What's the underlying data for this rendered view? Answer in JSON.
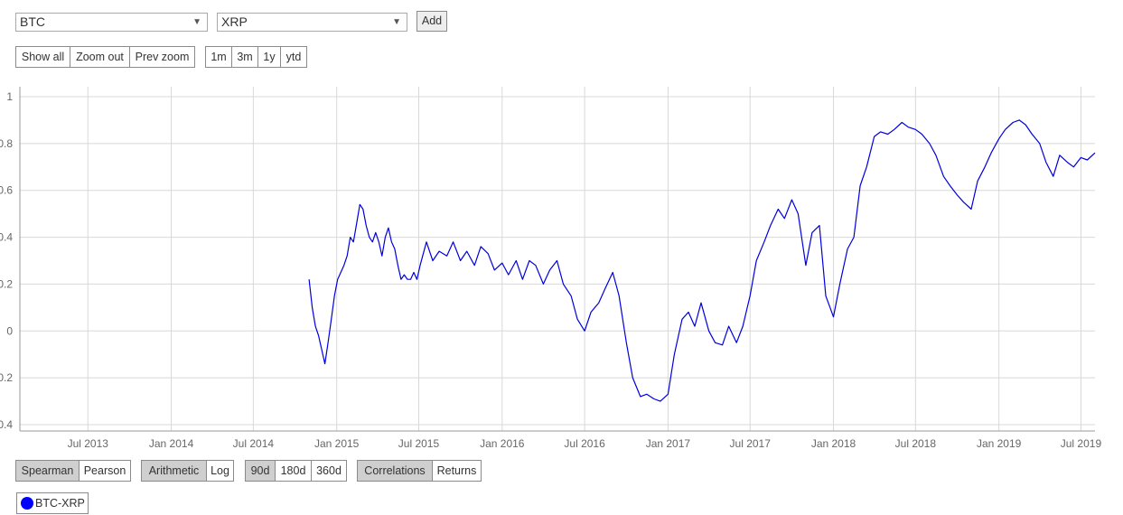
{
  "selects": {
    "first": {
      "value": "BTC"
    },
    "second": {
      "value": "XRP"
    }
  },
  "add_button": {
    "label": "Add"
  },
  "zoom_buttons": [
    "Show all",
    "Zoom out",
    "Prev zoom"
  ],
  "range_buttons": [
    "1m",
    "3m",
    "1y",
    "ytd"
  ],
  "method_buttons": {
    "active": "Spearman",
    "other": "Pearson"
  },
  "scale_buttons": {
    "active": "Arithmetic",
    "other": "Log"
  },
  "window_buttons": {
    "active": "90d",
    "b": "180d",
    "c": "360d"
  },
  "view_buttons": {
    "active": "Correlations",
    "other": "Returns"
  },
  "legend": {
    "label": "BTC-XRP",
    "color": "#0000ff"
  },
  "colors": {
    "line": "#0000dd",
    "grid": "#d8d8d8",
    "active_button": "#cfcfcf"
  },
  "chart_data": {
    "type": "line",
    "title": "",
    "xlabel": "",
    "ylabel": "",
    "ylim": [
      -0.4,
      1
    ],
    "xlim": [
      "2013-02-01",
      "2019-08-01"
    ],
    "yticks": [
      "1",
      "0.8",
      "0.6",
      "0.4",
      "0.2",
      "0",
      "0.2",
      "0.4"
    ],
    "xticks": [
      {
        "date": "2013-07-01",
        "label": "Jul 2013"
      },
      {
        "date": "2014-01-01",
        "label": "Jan 2014"
      },
      {
        "date": "2014-07-01",
        "label": "Jul 2014"
      },
      {
        "date": "2015-01-01",
        "label": "Jan 2015"
      },
      {
        "date": "2015-07-01",
        "label": "Jul 2015"
      },
      {
        "date": "2016-01-01",
        "label": "Jan 2016"
      },
      {
        "date": "2016-07-01",
        "label": "Jul 2016"
      },
      {
        "date": "2017-01-01",
        "label": "Jan 2017"
      },
      {
        "date": "2017-07-01",
        "label": "Jul 2017"
      },
      {
        "date": "2018-01-01",
        "label": "Jan 2018"
      },
      {
        "date": "2018-07-01",
        "label": "Jul 2018"
      },
      {
        "date": "2019-01-01",
        "label": "Jan 2019"
      },
      {
        "date": "2019-07-01",
        "label": "Jul 2019"
      }
    ],
    "grid": true,
    "series": [
      {
        "name": "BTC-XRP",
        "color": "#0000dd",
        "x": [
          "2014-11-01",
          "2014-11-08",
          "2014-11-15",
          "2014-11-22",
          "2014-11-29",
          "2014-12-06",
          "2014-12-13",
          "2014-12-20",
          "2014-12-27",
          "2015-01-03",
          "2015-01-10",
          "2015-01-17",
          "2015-01-24",
          "2015-01-31",
          "2015-02-07",
          "2015-02-14",
          "2015-02-21",
          "2015-02-28",
          "2015-03-07",
          "2015-03-14",
          "2015-03-21",
          "2015-03-28",
          "2015-04-04",
          "2015-04-11",
          "2015-04-18",
          "2015-04-25",
          "2015-05-02",
          "2015-05-09",
          "2015-05-16",
          "2015-05-23",
          "2015-05-30",
          "2015-06-06",
          "2015-06-13",
          "2015-06-20",
          "2015-06-27",
          "2015-07-04",
          "2015-07-18",
          "2015-08-01",
          "2015-08-15",
          "2015-09-01",
          "2015-09-15",
          "2015-10-01",
          "2015-10-15",
          "2015-11-01",
          "2015-11-15",
          "2015-12-01",
          "2015-12-15",
          "2016-01-01",
          "2016-01-15",
          "2016-02-01",
          "2016-02-15",
          "2016-03-01",
          "2016-03-15",
          "2016-04-01",
          "2016-04-15",
          "2016-05-01",
          "2016-05-15",
          "2016-06-01",
          "2016-06-15",
          "2016-07-01",
          "2016-07-15",
          "2016-08-01",
          "2016-08-15",
          "2016-09-01",
          "2016-09-15",
          "2016-10-01",
          "2016-10-15",
          "2016-11-01",
          "2016-11-15",
          "2016-12-01",
          "2016-12-15",
          "2017-01-01",
          "2017-01-15",
          "2017-02-01",
          "2017-02-15",
          "2017-03-01",
          "2017-03-15",
          "2017-04-01",
          "2017-04-15",
          "2017-05-01",
          "2017-05-15",
          "2017-06-01",
          "2017-06-15",
          "2017-07-01",
          "2017-07-15",
          "2017-08-01",
          "2017-08-15",
          "2017-09-01",
          "2017-09-15",
          "2017-10-01",
          "2017-10-15",
          "2017-11-01",
          "2017-11-15",
          "2017-12-01",
          "2017-12-15",
          "2018-01-01",
          "2018-01-15",
          "2018-02-01",
          "2018-02-15",
          "2018-03-01",
          "2018-03-15",
          "2018-04-01",
          "2018-04-15",
          "2018-05-01",
          "2018-05-15",
          "2018-06-01",
          "2018-06-15",
          "2018-07-01",
          "2018-07-15",
          "2018-08-01",
          "2018-08-15",
          "2018-09-01",
          "2018-09-15",
          "2018-10-01",
          "2018-10-15",
          "2018-11-01",
          "2018-11-15",
          "2018-12-01",
          "2018-12-15",
          "2019-01-01",
          "2019-01-15",
          "2019-02-01",
          "2019-02-15",
          "2019-03-01",
          "2019-03-15",
          "2019-04-01",
          "2019-04-15",
          "2019-05-01",
          "2019-05-15",
          "2019-06-01",
          "2019-06-15",
          "2019-07-01",
          "2019-07-15",
          "2019-08-01"
        ],
        "values": [
          0.22,
          0.1,
          0.02,
          -0.02,
          -0.08,
          -0.14,
          -0.05,
          0.05,
          0.15,
          0.22,
          0.25,
          0.28,
          0.32,
          0.4,
          0.38,
          0.46,
          0.54,
          0.52,
          0.45,
          0.4,
          0.38,
          0.42,
          0.38,
          0.32,
          0.4,
          0.44,
          0.38,
          0.35,
          0.28,
          0.22,
          0.24,
          0.22,
          0.22,
          0.25,
          0.22,
          0.28,
          0.38,
          0.3,
          0.34,
          0.32,
          0.38,
          0.3,
          0.34,
          0.28,
          0.36,
          0.33,
          0.26,
          0.29,
          0.24,
          0.3,
          0.22,
          0.3,
          0.28,
          0.2,
          0.26,
          0.3,
          0.2,
          0.15,
          0.05,
          0.0,
          0.08,
          0.12,
          0.18,
          0.25,
          0.15,
          -0.05,
          -0.2,
          -0.28,
          -0.27,
          -0.29,
          -0.3,
          -0.27,
          -0.1,
          0.05,
          0.08,
          0.02,
          0.12,
          0.0,
          -0.05,
          -0.06,
          0.02,
          -0.05,
          0.02,
          0.15,
          0.3,
          0.38,
          0.45,
          0.52,
          0.48,
          0.56,
          0.5,
          0.28,
          0.42,
          0.45,
          0.15,
          0.06,
          0.2,
          0.35,
          0.4,
          0.62,
          0.7,
          0.83,
          0.85,
          0.84,
          0.86,
          0.89,
          0.87,
          0.86,
          0.84,
          0.8,
          0.75,
          0.66,
          0.62,
          0.58,
          0.55,
          0.52,
          0.64,
          0.7,
          0.76,
          0.82,
          0.86,
          0.89,
          0.9,
          0.88,
          0.84,
          0.8,
          0.72,
          0.66,
          0.75,
          0.72,
          0.7,
          0.74,
          0.73,
          0.76
        ]
      }
    ]
  }
}
